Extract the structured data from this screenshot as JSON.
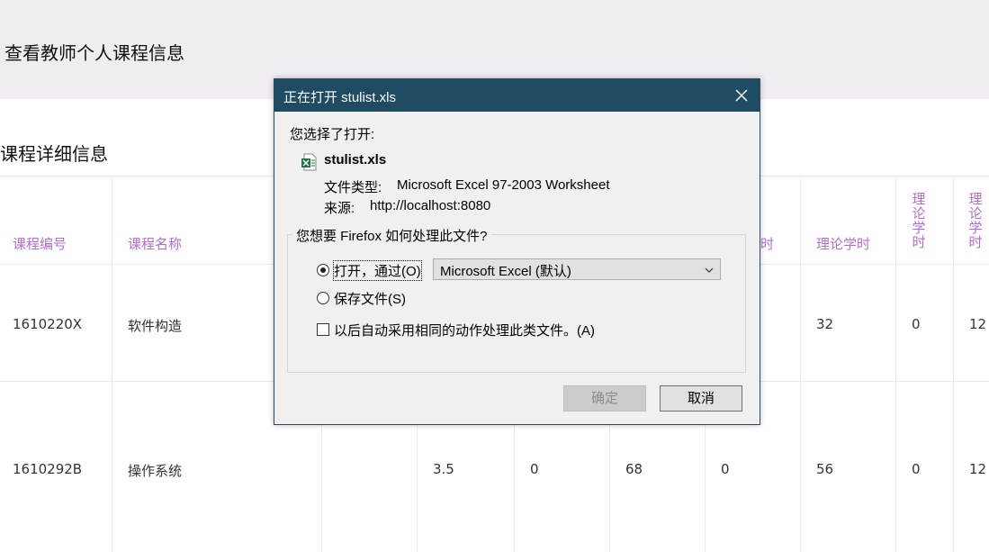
{
  "header": {
    "title": "查看教师个人课程信息"
  },
  "section": {
    "title": "课程详细信息"
  },
  "table": {
    "headers": [
      "课程编号",
      "课程名称",
      "学时",
      "理论学时",
      "理",
      "理"
    ],
    "vertical_header_1": [
      "理",
      "论",
      "学",
      "时"
    ],
    "vertical_header_2": [
      "理",
      "论",
      "学",
      "时"
    ],
    "rows": [
      {
        "code": "1610220X",
        "name": "软件构造",
        "c3": "",
        "c4": "",
        "c5": "",
        "c6": "",
        "c7": "",
        "c8": "32",
        "c9": "0",
        "c10": "12"
      },
      {
        "code": "1610292B",
        "name": "操作系统",
        "c3": "",
        "c4": "3.5",
        "c5": "0",
        "c6": "68",
        "c7": "0",
        "c8": "56",
        "c9": "0",
        "c10": "12"
      }
    ]
  },
  "dialog": {
    "title": "正在打开 stulist.xls",
    "chose_label": "您选择了打开:",
    "file_name": "stulist.xls",
    "type_label": "文件类型:",
    "type_value": "Microsoft Excel 97-2003 Worksheet",
    "source_label": "来源:",
    "source_value": "http://localhost:8080",
    "question": "您想要 Firefox 如何处理此文件?",
    "open_with_label": "打开，通过(O)",
    "open_with_app": "Microsoft Excel (默认)",
    "save_label": "保存文件(S)",
    "auto_label": "以后自动采用相同的动作处理此类文件。(A)",
    "ok_label": "确定",
    "cancel_label": "取消",
    "open_with_selected": true,
    "auto_checked": false
  },
  "colors": {
    "header_text": "#b46ed0",
    "banner": "#f1ebf2",
    "titlebar": "#1f4b63"
  }
}
